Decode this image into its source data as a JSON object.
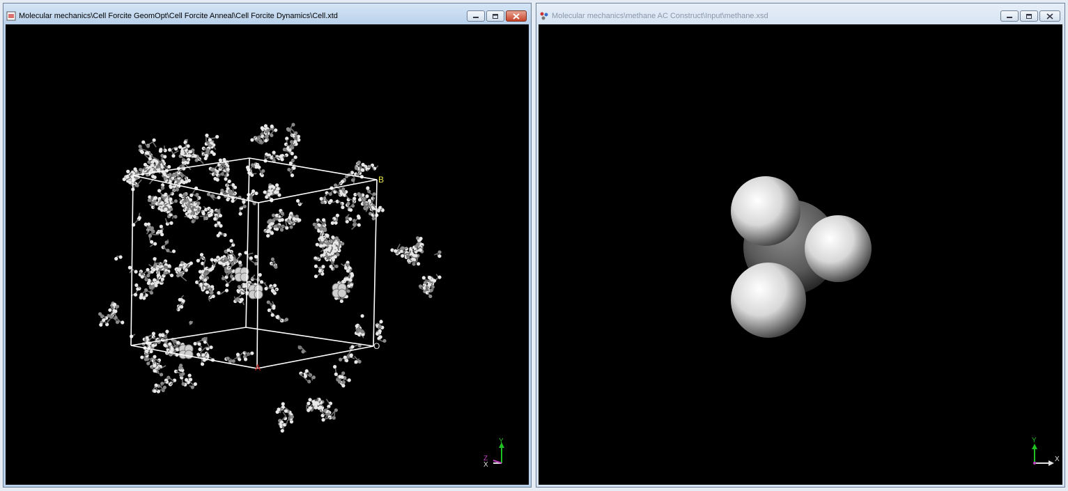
{
  "left_window": {
    "title": "Molecular mechanics\\Cell Forcite GeomOpt\\Cell Forcite Anneal\\Cell Forcite Dynamics\\Cell.xtd",
    "cell_labels": {
      "b": "B",
      "o": "O",
      "a": "A"
    },
    "axes": {
      "y": "Y",
      "x": "X",
      "z": "Z"
    }
  },
  "right_window": {
    "title": "Molecular mechanics\\methane AC Construct\\Input\\methane.xsd",
    "axes": {
      "y": "Y",
      "x": "X"
    }
  },
  "colors": {
    "background": "#000000",
    "cell_edges": "#ffffff",
    "carbon": "#6e6e6e",
    "hydrogen": "#e8e8e8",
    "b_label": "#e8e84a",
    "a_label": "#d02020",
    "y_axis": "#20c020",
    "x_axis": "#e0e0e0",
    "z_axis": "#c040c0"
  }
}
